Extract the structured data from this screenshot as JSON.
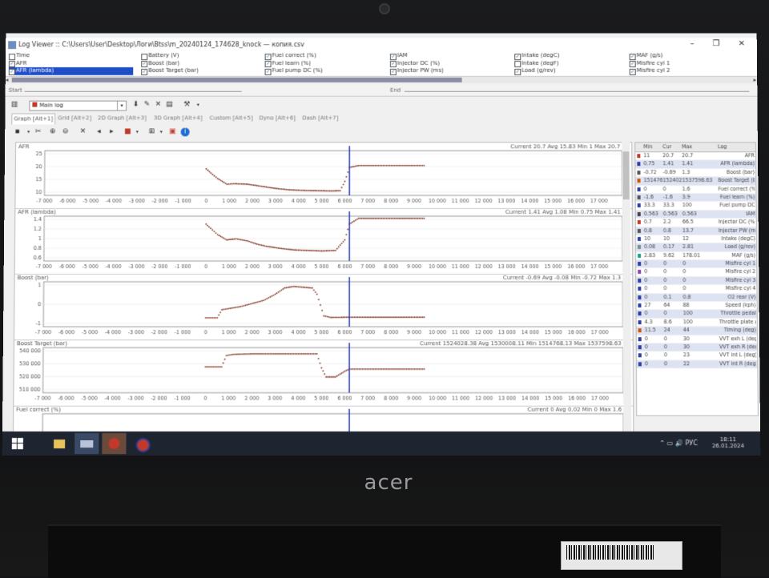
{
  "window": {
    "title": "Log Viewer :: C:\\Users\\User\\Desktop\\Логи\\Btss\\m_20240124_174628_knock — копия.csv"
  },
  "params": {
    "col1": [
      {
        "label": "Time",
        "checked": false,
        "selected": false
      },
      {
        "label": "AFR",
        "checked": true,
        "selected": false
      },
      {
        "label": "AFR (lambda)",
        "checked": true,
        "selected": true
      }
    ],
    "col2": [
      {
        "label": "Battery (V)",
        "checked": false,
        "selected": false
      },
      {
        "label": "Boost (bar)",
        "checked": true,
        "selected": false
      },
      {
        "label": "Boost Target (bar)",
        "checked": true,
        "selected": false
      }
    ],
    "col3": [
      {
        "label": "Fuel correct (%)",
        "checked": true,
        "selected": false
      },
      {
        "label": "Fuel learn (%)",
        "checked": true,
        "selected": false
      },
      {
        "label": "Fuel pump DC (%)",
        "checked": true,
        "selected": false
      }
    ],
    "col4": [
      {
        "label": "IAM",
        "checked": true,
        "selected": false
      },
      {
        "label": "Injector DC (%)",
        "checked": true,
        "selected": false
      },
      {
        "label": "Injector PW (ms)",
        "checked": true,
        "selected": false
      }
    ],
    "col5": [
      {
        "label": "Intake (degC)",
        "checked": true,
        "selected": false
      },
      {
        "label": "Intake (degF)",
        "checked": false,
        "selected": false
      },
      {
        "label": "Load (g/rev)",
        "checked": true,
        "selected": false
      }
    ],
    "col6": [
      {
        "label": "MAF (g/s)",
        "checked": true,
        "selected": false
      },
      {
        "label": "Misfire cyl 1",
        "checked": true,
        "selected": false
      },
      {
        "label": "Misfire cyl 2",
        "checked": true,
        "selected": false
      }
    ]
  },
  "startend": {
    "start": "Start",
    "end": "End"
  },
  "toolbar": {
    "log_select": "Main log"
  },
  "tabs": [
    "Graph [Alt+1]",
    "Grid [Alt+2]",
    "2D Graph [Alt+3]",
    "3D Graph [Alt+4]",
    "Custom [Alt+5]",
    "Dyno [Alt+6]",
    "Dash [Alt+7]"
  ],
  "x_ticks": [
    "-7 000",
    "-6 000",
    "-5 000",
    "-4 000",
    "-3 000",
    "-2 000",
    "-1 000",
    "0",
    "1 000",
    "2 000",
    "3 000",
    "4 000",
    "5 000",
    "6 000",
    "7 000",
    "8 000",
    "9 000",
    "10 000",
    "11 000",
    "12 000",
    "13 000",
    "14 000",
    "15 000",
    "16 000",
    "17 000"
  ],
  "panels": [
    {
      "title": "AFR",
      "stats": "Current 20.7 Avg 15.83 Min 1  Max 20.7",
      "yticks": [
        "25",
        "20",
        "15",
        "10"
      ]
    },
    {
      "title": "AFR (lambda)",
      "stats": "Current 1.41 Avg 1.08 Min 0.75 Max 1.41",
      "yticks": [
        "1.4",
        "1.2",
        "1",
        "0.8",
        "0.6"
      ]
    },
    {
      "title": "Boost (bar)",
      "stats": "Current -0.69 Avg -0.08 Min -0.72 Max 1.3",
      "yticks": [
        "1",
        "0",
        "-1"
      ]
    },
    {
      "title": "Boost Target (bar)",
      "stats": "Current 1524028.38 Avg 1530008.11 Min 1514768.13 Max 1537598.63",
      "yticks": [
        "540 000",
        "530 000",
        "520 000",
        "510 000"
      ]
    },
    {
      "title": "Fuel correct (%)",
      "stats": "Current 0 Avg 0.02 Min 0 Max 1.6",
      "yticks": []
    }
  ],
  "legend": {
    "headers": [
      "Min",
      "Cur",
      "Max",
      "Log"
    ],
    "rows": [
      {
        "color": "#c0392b",
        "min": "11",
        "cur": "20.7",
        "max": "20.7",
        "name": "AFR"
      },
      {
        "color": "#2c3e9e",
        "min": "0.75",
        "cur": "1.41",
        "max": "1.41",
        "name": "AFR (lambda)"
      },
      {
        "color": "#555555",
        "min": "-0.72",
        "cur": "-0.69",
        "max": "1.3",
        "name": "Boost (bar)"
      },
      {
        "color": "#d35400",
        "min": "151476",
        "cur": "152402",
        "max": "1537598.63",
        "name": "Boost Target (b"
      },
      {
        "color": "#2c3e9e",
        "min": "0",
        "cur": "0",
        "max": "1.6",
        "name": "Fuel correct (%"
      },
      {
        "color": "#555555",
        "min": "-1.6",
        "cur": "-1.6",
        "max": "3.9",
        "name": "Fuel learn (%)"
      },
      {
        "color": "#2c3e9e",
        "min": "33.3",
        "cur": "33.3",
        "max": "100",
        "name": "Fuel pump DC"
      },
      {
        "color": "#444444",
        "min": "0.563",
        "cur": "0.563",
        "max": "0.563",
        "name": "IAM"
      },
      {
        "color": "#c0392b",
        "min": "0.7",
        "cur": "2.2",
        "max": "66.5",
        "name": "Injector DC (%)"
      },
      {
        "color": "#555555",
        "min": "0.8",
        "cur": "0.8",
        "max": "13.7",
        "name": "Injector PW (m"
      },
      {
        "color": "#2c3e9e",
        "min": "10",
        "cur": "10",
        "max": "12",
        "name": "Intake (degC)"
      },
      {
        "color": "#7f8c8d",
        "min": "0.08",
        "cur": "0.17",
        "max": "2.81",
        "name": "Load (g/rev)"
      },
      {
        "color": "#16a085",
        "min": "2.83",
        "cur": "9.62",
        "max": "178.01",
        "name": "MAF (g/s)"
      },
      {
        "color": "#2c3e9e",
        "min": "0",
        "cur": "0",
        "max": "0",
        "name": "Misfire cyl 1"
      },
      {
        "color": "#8e44ad",
        "min": "0",
        "cur": "0",
        "max": "0",
        "name": "Misfire cyl 2"
      },
      {
        "color": "#2c3e9e",
        "min": "0",
        "cur": "0",
        "max": "0",
        "name": "Misfire cyl 3"
      },
      {
        "color": "#2c3e9e",
        "min": "0",
        "cur": "0",
        "max": "0",
        "name": "Misfire cyl 4"
      },
      {
        "color": "#2c3e9e",
        "min": "0",
        "cur": "0.1",
        "max": "0.8",
        "name": "O2 rear (V)"
      },
      {
        "color": "#2c3e9e",
        "min": "27",
        "cur": "64",
        "max": "88",
        "name": "Speed (kph)"
      },
      {
        "color": "#2c3e9e",
        "min": "0",
        "cur": "0",
        "max": "100",
        "name": "Throttle pedal"
      },
      {
        "color": "#2c3e9e",
        "min": "4.3",
        "cur": "8.6",
        "max": "100",
        "name": "Throttle plate ("
      },
      {
        "color": "#d35400",
        "min": "11.5",
        "cur": "24",
        "max": "44",
        "name": "Timing (deg)"
      },
      {
        "color": "#2c3e9e",
        "min": "0",
        "cur": "0",
        "max": "30",
        "name": "VVT exh L (deg"
      },
      {
        "color": "#2c3e9e",
        "min": "0",
        "cur": "0",
        "max": "30",
        "name": "VVT exh R (deg"
      },
      {
        "color": "#2c3e9e",
        "min": "0",
        "cur": "0",
        "max": "23",
        "name": "VVT int L (deg)"
      },
      {
        "color": "#2c3e9e",
        "min": "0",
        "cur": "0",
        "max": "22",
        "name": "VVT int R (deg)"
      }
    ]
  },
  "taskbar": {
    "lang": "РУС",
    "time": "18:11",
    "date": "26.01.2024"
  },
  "laptop": {
    "brand": "acer"
  }
}
